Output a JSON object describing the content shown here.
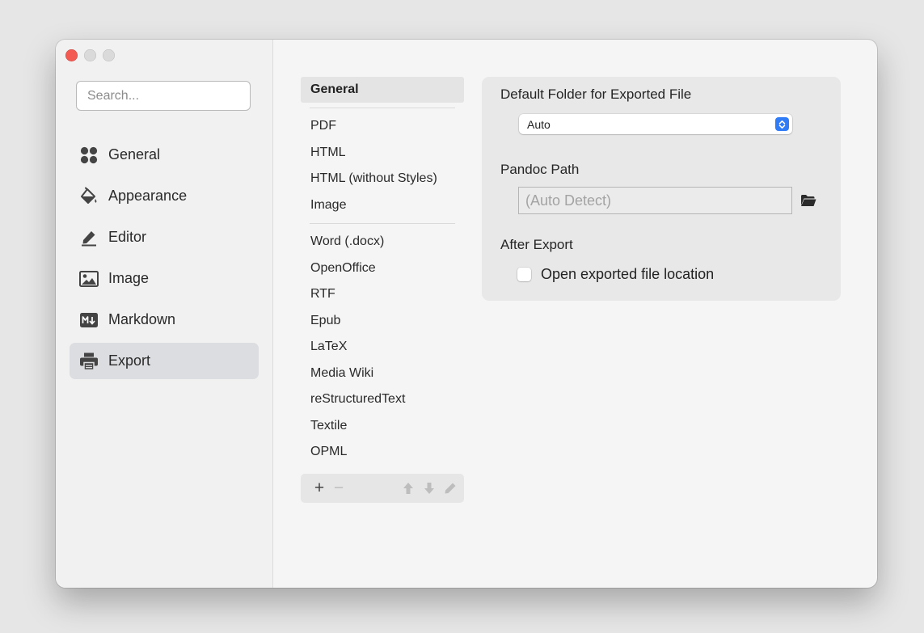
{
  "search": {
    "placeholder": "Search..."
  },
  "sidebar": {
    "items": [
      {
        "label": "General",
        "icon": "general-icon"
      },
      {
        "label": "Appearance",
        "icon": "paint-bucket-icon"
      },
      {
        "label": "Editor",
        "icon": "pencil-icon"
      },
      {
        "label": "Image",
        "icon": "image-icon"
      },
      {
        "label": "Markdown",
        "icon": "markdown-icon"
      },
      {
        "label": "Export",
        "icon": "printer-icon",
        "active": true
      }
    ]
  },
  "formats": {
    "header": "General",
    "group1": [
      "PDF",
      "HTML",
      "HTML (without Styles)",
      "Image"
    ],
    "group2": [
      "Word (.docx)",
      "OpenOffice",
      "RTF",
      "Epub",
      "LaTeX",
      "Media Wiki",
      "reStructuredText",
      "Textile",
      "OPML"
    ],
    "toolbar": {
      "add": "+",
      "remove": "−"
    }
  },
  "settings": {
    "default_folder_label": "Default Folder for Exported File",
    "default_folder_value": "Auto",
    "pandoc_label": "Pandoc Path",
    "pandoc_placeholder": "(Auto Detect)",
    "after_export_label": "After Export",
    "open_location_label": "Open exported file location",
    "open_location_checked": false
  },
  "colors": {
    "accent": "#2f7cf6",
    "close": "#f25a52",
    "active_bg": "#dcdde0"
  }
}
